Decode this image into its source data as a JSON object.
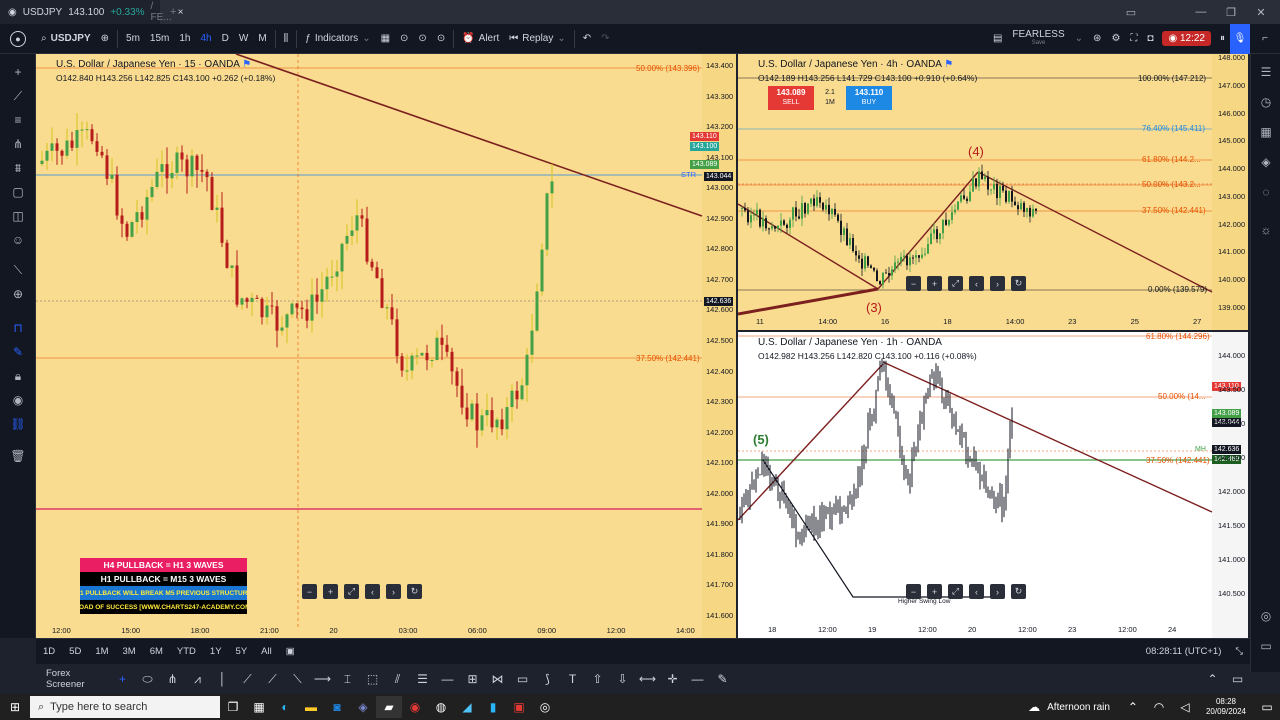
{
  "browser": {
    "tab_symbol": "USDJPY",
    "tab_price": "143.100",
    "tab_change": "+0.33%",
    "tab_suffix": "/ FE..."
  },
  "header": {
    "symbol": "USDJPY",
    "timeframes": [
      "5m",
      "15m",
      "1h",
      "4h",
      "D",
      "W",
      "M"
    ],
    "indicators_label": "Indicators",
    "alert_label": "Alert",
    "replay_label": "Replay",
    "layout_name": "FEARLESS",
    "layout_sub": "Save",
    "timer": "12:22"
  },
  "main_chart": {
    "title": "U.S. Dollar / Japanese Yen · 15 · OANDA",
    "ohlc": "O142.840 H143.256 L142.825 C143.100 +0.262 (+0.18%)",
    "fib_50": "50.00% (143.396)",
    "fib_375": "37.50% (142.441)",
    "y_ticks": [
      "143.400",
      "143.300",
      "143.200",
      "143.100",
      "143.000",
      "142.900",
      "142.800",
      "142.700",
      "142.600",
      "142.500",
      "142.400",
      "142.300",
      "142.200",
      "142.100",
      "142.000",
      "141.900",
      "141.800",
      "141.700",
      "141.600"
    ],
    "x_ticks": [
      "12:00",
      "15:00",
      "18:00",
      "21:00",
      "20",
      "03:00",
      "06:00",
      "09:00",
      "12:00",
      "14:00"
    ],
    "tag_ask": "143.110",
    "tag_sym": "143.100",
    "tag_bid": "143.089",
    "tag_str": "143.044",
    "tag_str_label": "STR",
    "tag_cross": "142.636",
    "notes": [
      "H4 PULLBACK = H1 3 WAVES",
      "H1 PULLBACK = M15 3 WAVES",
      "H1 PULLBACK WILL BREAK M5 PREVIOUS STRUCTURE",
      "ROAD OF SUCCESS [WWW.CHARTS247-ACADEMY.COM]"
    ]
  },
  "chart_4h": {
    "title": "U.S. Dollar / Japanese Yen · 4h · OANDA",
    "ohlc": "O142.189 H143.256 L141.729 C143.100 +0.910 (+0.64%)",
    "sell_price": "143.089",
    "sell_label": "SELL",
    "spread": "2.1",
    "qty": "1M",
    "buy_price": "143.110",
    "buy_label": "BUY",
    "fib_100": "100.00% (147.212)",
    "fib_764": "76.40% (145.411)",
    "fib_618": "61.80% (144.2...",
    "fib_50": "50.00% (143.2...",
    "fib_375": "37.50% (142.441)",
    "fib_0": "0.00% (139.579)",
    "wave4": "(4)",
    "wave3": "(3)",
    "y_ticks": [
      "148.000",
      "147.000",
      "146.000",
      "145.000",
      "144.000",
      "143.000",
      "142.000",
      "141.000",
      "140.000",
      "139.000"
    ],
    "x_ticks": [
      "11",
      "14:00",
      "16",
      "18",
      "14:00",
      "23",
      "25",
      "27"
    ]
  },
  "chart_1h": {
    "title": "U.S. Dollar / Japanese Yen · 1h · OANDA",
    "ohlc": "O142.982 H143.256 L142.820 C143.100 +0.116 (+0.08%)",
    "fib_618": "61.80% (144.296)",
    "fib_50": "50.00% (14...",
    "fib_375": "37.50% (142.441)",
    "wave5": "(5)",
    "mh_label": "MH",
    "swing_label": "Higher Swing Low",
    "y_ticks": [
      "144.000",
      "143.500",
      "143.000",
      "142.500",
      "142.000",
      "141.500",
      "141.000",
      "140.500"
    ],
    "x_ticks": [
      "18",
      "12:00",
      "19",
      "12:00",
      "20",
      "12:00",
      "23",
      "12:00",
      "24"
    ],
    "tag_ask": "143.110",
    "tag_bid": "143.089",
    "tag_str": "143.044",
    "tag_cross": "142.636",
    "tag_green": "142.469"
  },
  "bottom": {
    "ranges": [
      "1D",
      "5D",
      "1M",
      "3M",
      "6M",
      "YTD",
      "1Y",
      "5Y",
      "All"
    ],
    "clock": "08:28:11 (UTC+1)",
    "screener": "Forex Screener"
  },
  "taskbar": {
    "search_placeholder": "Type here to search",
    "weather": "Afternoon rain",
    "time": "08:28",
    "date": "20/09/2024"
  },
  "colors": {
    "chart_bg": "#f9dc8f",
    "down_candle": "#b71c1c",
    "up_candle": "#43a047",
    "wick_yellow": "#d4c51e",
    "trendline": "#7b1f1f",
    "accent": "#2962ff"
  }
}
